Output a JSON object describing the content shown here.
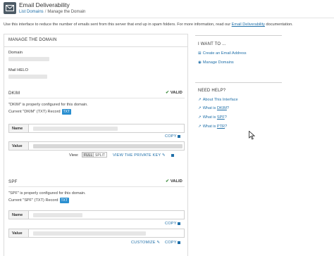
{
  "header": {
    "title": "Email Deliverability",
    "breadcrumb": {
      "parent": "List Domains",
      "separator": "/",
      "current": "Manage the Domain"
    }
  },
  "intro": {
    "text_before": "Use this interface to reduce the number of emails sent from this server that end up in spam folders. For more information, read our",
    "link": "Email Deliverability",
    "text_after": "documentation."
  },
  "panel": {
    "title": "MANAGE THE DOMAIN",
    "domain_label": "Domain",
    "helo_label": "Mail HELO",
    "dkim": {
      "title": "DKIM",
      "status": "VALID",
      "message": "\"DKIM\" is properly configured for this domain.",
      "record_label": "Current \"DKIM\" (TXT) Record",
      "record_badge": "TXT",
      "name_label": "Name",
      "value_label": "Value",
      "copy": "COPY",
      "view_label": "View:",
      "view_options": [
        "FULL",
        "SPLIT"
      ],
      "view_selected": "FULL",
      "private_key_link": "VIEW THE PRIVATE KEY"
    },
    "spf": {
      "title": "SPF",
      "status": "VALID",
      "message": "\"SPF\" is properly configured for this domain.",
      "record_label": "Current \"SPF\" (TXT) Record",
      "record_badge": "TXT",
      "name_label": "Name",
      "value_label": "Value",
      "copy": "COPY",
      "customize": "CUSTOMIZE"
    }
  },
  "sidebar": {
    "want_title": "I WANT TO ...",
    "want_items": [
      "Create an Email Address",
      "Manage Domains"
    ],
    "help_title": "NEED HELP?",
    "help_items": [
      {
        "prefix": "",
        "link": "About This Interface",
        "suffix": ""
      },
      {
        "prefix": "What is ",
        "link": "DKIM",
        "suffix": "?"
      },
      {
        "prefix": "What is ",
        "link": "SPF",
        "suffix": "?"
      },
      {
        "prefix": "What is ",
        "link": "PTR",
        "suffix": "?"
      }
    ]
  },
  "colors": {
    "link": "#1f6fa8",
    "badge": "#2a8fd0",
    "valid_check": "#3c8b3c"
  },
  "icons": [
    "envelope-icon",
    "check-icon",
    "copy-icon",
    "pencil-icon",
    "plus-square-icon",
    "globe-icon",
    "external-link-icon",
    "cursor-icon"
  ]
}
